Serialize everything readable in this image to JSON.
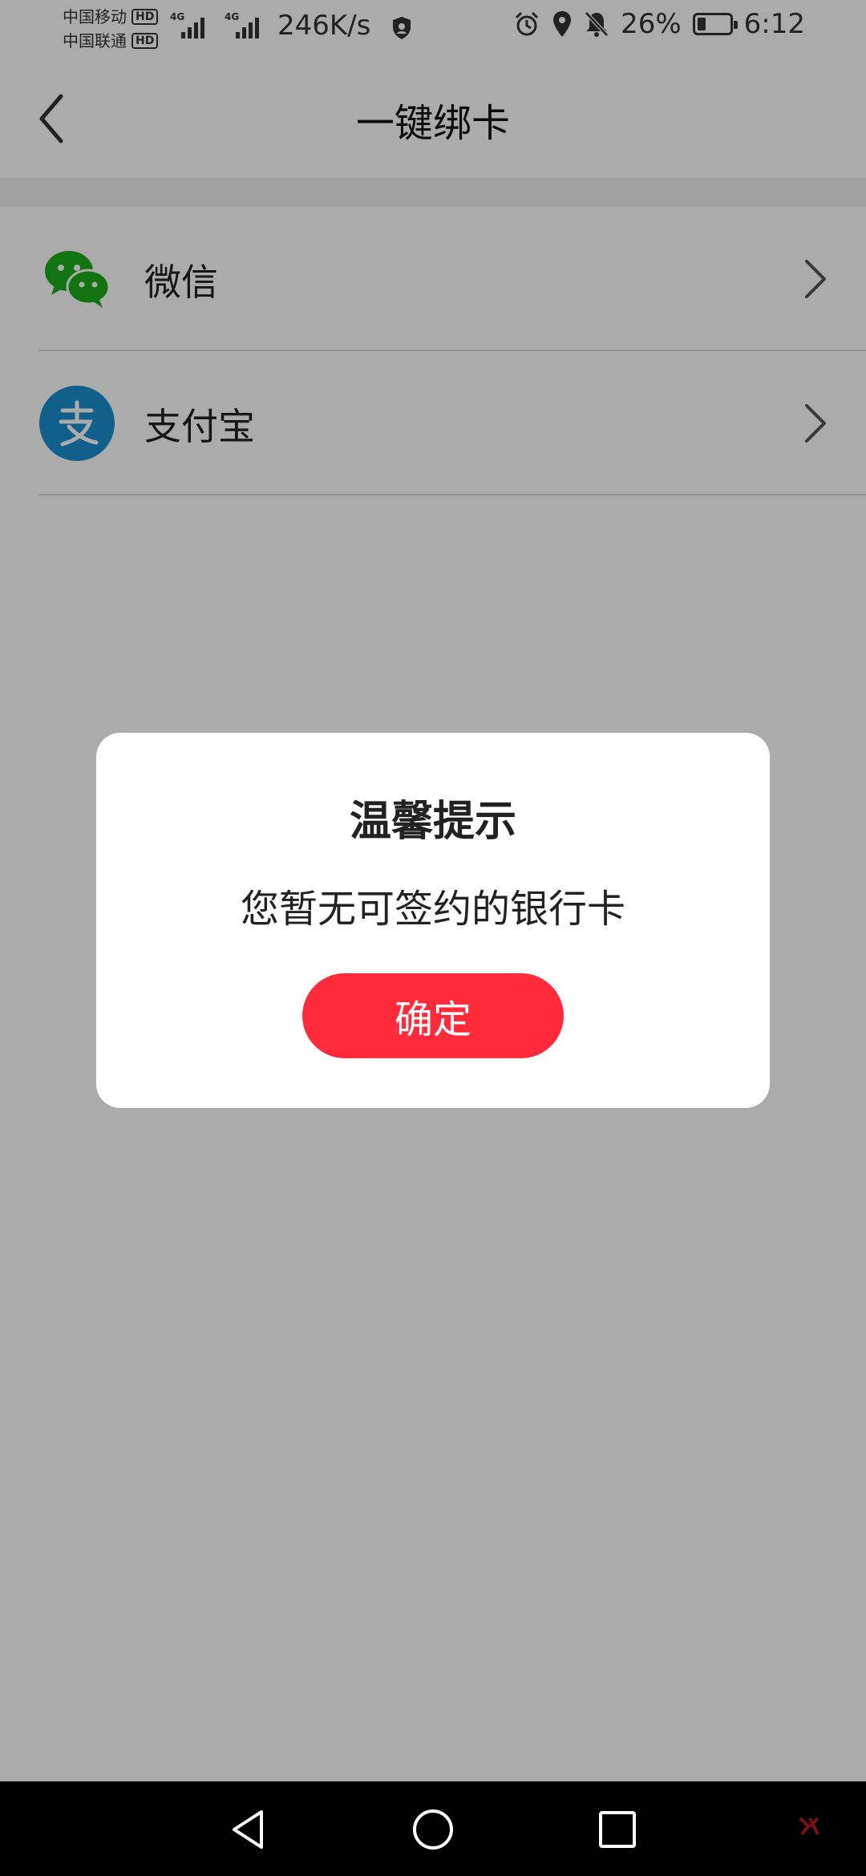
{
  "status_bar": {
    "carrier_1": "中国移动",
    "carrier_2": "中国联通",
    "hd_label": "HD",
    "network_tag": "4G",
    "net_speed": "246K/s",
    "battery_percent": "26%",
    "battery_level": 0.26,
    "time": "6:12",
    "icons": [
      "shield-icon",
      "alarm-icon",
      "location-icon",
      "mute-bell-icon",
      "battery-icon"
    ]
  },
  "header": {
    "title": "一键绑卡",
    "back_icon": "chevron-left-icon"
  },
  "list": {
    "items": [
      {
        "label": "微信",
        "icon": "wechat-icon"
      },
      {
        "label": "支付宝",
        "icon": "alipay-icon"
      }
    ]
  },
  "dialog": {
    "title": "温馨提示",
    "message": "您暂无可签约的银行卡",
    "confirm_label": "确定"
  },
  "nav_bar": {
    "icons": [
      "back-triangle-icon",
      "home-circle-icon",
      "recents-square-icon"
    ]
  },
  "colors": {
    "accent_red": "#ff2a3a",
    "wechat_green": "#1aad19",
    "alipay_blue": "#1a8ed0"
  }
}
